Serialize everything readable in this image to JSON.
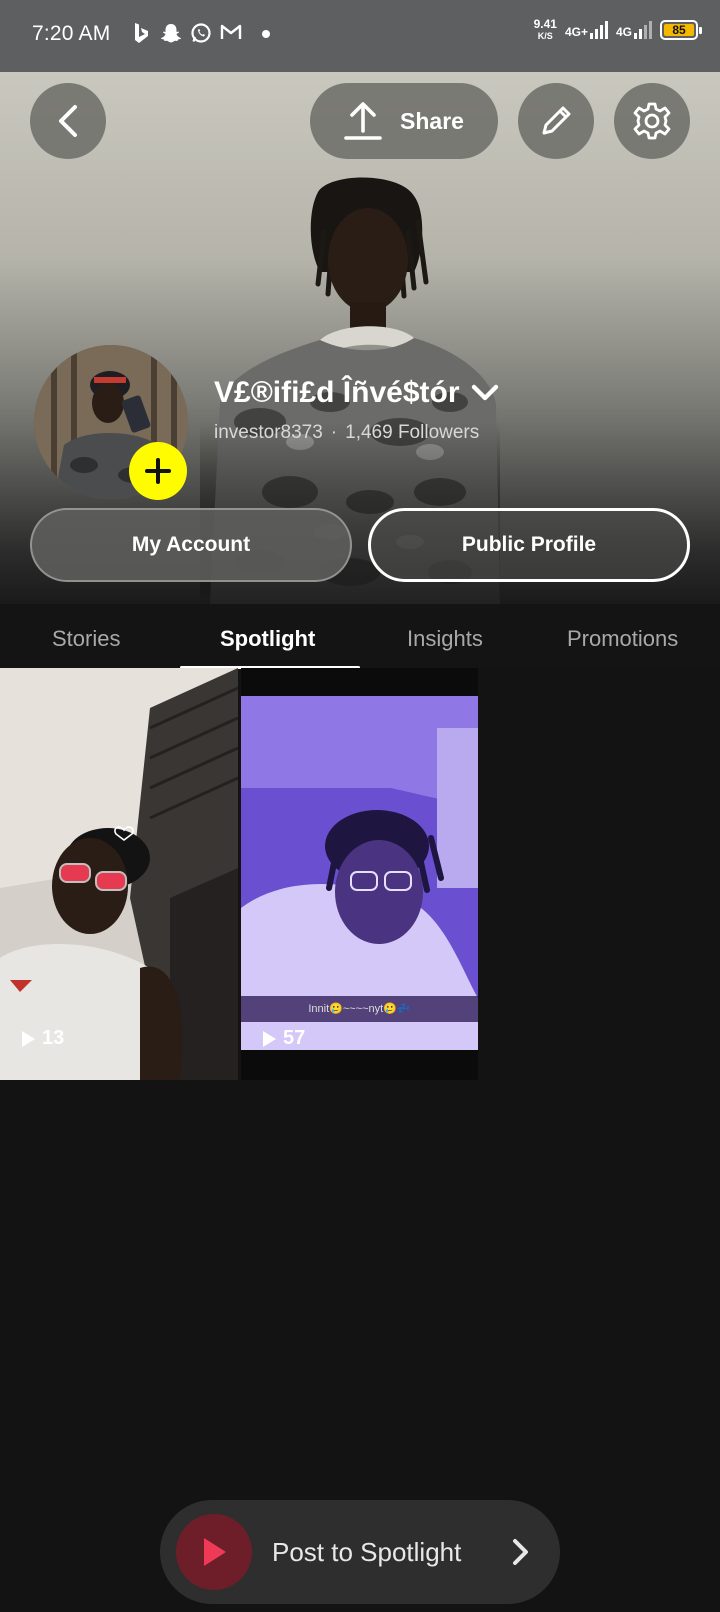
{
  "status_bar": {
    "time": "7:20 AM",
    "speed_value": "9.41",
    "speed_unit": "K/S",
    "net1": "4G+",
    "net2": "4G",
    "battery": "85",
    "notification_icons": [
      "bing-icon",
      "snapchat-icon",
      "whatsapp-icon",
      "gmail-icon"
    ]
  },
  "header": {
    "share_label": "Share"
  },
  "profile": {
    "display_name": "V£®ifi£d Îñvé$tór",
    "username": "investor8373",
    "separator": "·",
    "followers": "1,469 Followers"
  },
  "buttons": {
    "my_account": "My Account",
    "public_profile": "Public Profile"
  },
  "tabs": [
    {
      "label": "Stories",
      "active": false
    },
    {
      "label": "Spotlight",
      "active": true
    },
    {
      "label": "Insights",
      "active": false
    },
    {
      "label": "Promotions",
      "active": false
    }
  ],
  "spotlight_items": [
    {
      "views": "13",
      "caption": ""
    },
    {
      "views": "57",
      "caption": "Innit🥲~~~~nyt🥲💤"
    }
  ],
  "footer": {
    "post_label": "Post to Spotlight"
  },
  "colors": {
    "accent_yellow": "#fffc00",
    "post_button": "#6e1e28",
    "play_red": "#ee3a57"
  }
}
